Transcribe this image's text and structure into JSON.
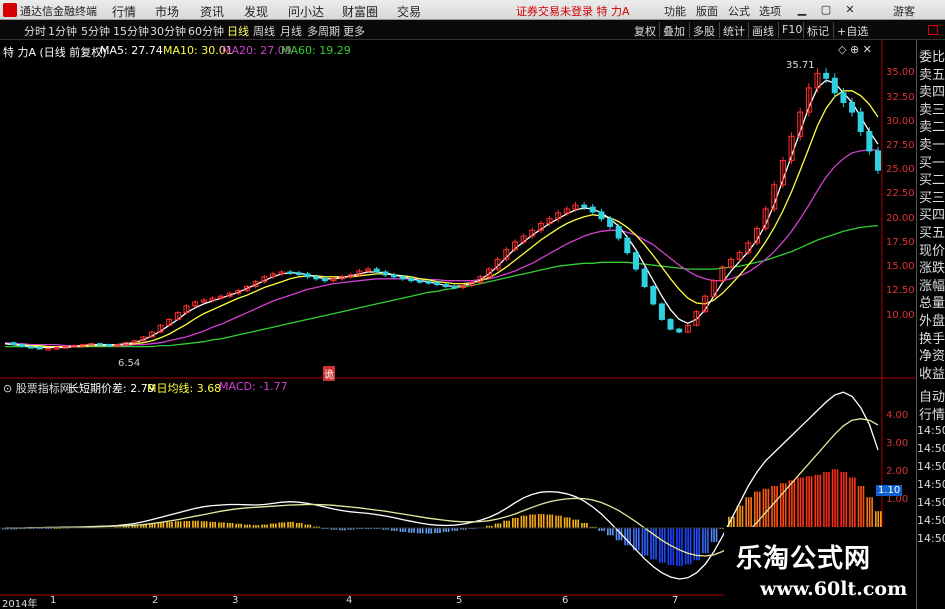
{
  "app": {
    "title": "通达信金融终端",
    "menu": [
      "行情",
      "市场",
      "资讯",
      "发现",
      "问小达",
      "财富圈",
      "交易"
    ],
    "status_warning": "证券交易未登录  特 力A",
    "right_menu": [
      "功能",
      "版面",
      "公式",
      "选项"
    ],
    "user": "游客"
  },
  "toolbar": {
    "periods": [
      "分时",
      "1分钟",
      "5分钟",
      "15分钟",
      "30分钟",
      "60分钟",
      "日线",
      "周线",
      "月线",
      "多周期",
      "更多"
    ],
    "active_period": "日线",
    "tools": [
      "复权",
      "叠加",
      "多股",
      "统计",
      "画线",
      "F10",
      "标记",
      "+自选"
    ],
    "side_corner": "L\n₩"
  },
  "stock": {
    "name_line": "特 力A  (日线 前复权)",
    "ma_legend": [
      {
        "label": "MA5: 27.74",
        "color": "#ffffff"
      },
      {
        "label": "MA10: 30.01",
        "color": "#ffff40"
      },
      {
        "label": "MA20: 27.09",
        "color": "#d040d0"
      },
      {
        "label": "MA60: 19.29",
        "color": "#30d030"
      }
    ],
    "high_label": "35.71",
    "low_label": "6.54",
    "marker": "诡",
    "y_axis": [
      "35.00",
      "32.50",
      "30.00",
      "27.50",
      "25.00",
      "22.50",
      "20.00",
      "17.50",
      "15.00",
      "12.50",
      "10.00"
    ]
  },
  "macd": {
    "title": "股票指标网",
    "legend": [
      {
        "label": "长短期价差: 2.79",
        "color": "#ffffff"
      },
      {
        "label": "M日均线: 3.68",
        "color": "#ffff40"
      },
      {
        "label": "MACD: -1.77",
        "color": "#d040d0"
      }
    ],
    "y_axis": [
      "4.00",
      "3.00",
      "2.00",
      "1.10",
      "1.00"
    ],
    "current_value": "1.10"
  },
  "x_axis": {
    "labels": [
      "2014年",
      "1",
      "2",
      "3",
      "4",
      "5",
      "6",
      "7"
    ]
  },
  "sidebar": {
    "labels": [
      "委比",
      "卖五",
      "卖四",
      "卖三",
      "卖二",
      "卖一",
      "买一",
      "买二",
      "买三",
      "买四",
      "买五",
      "现价",
      "涨跌",
      "涨幅",
      "总量",
      "外盘",
      "换手",
      "净资",
      "收益"
    ],
    "bottom_labels": [
      "自动",
      "行情"
    ],
    "times": [
      "14:50",
      "14:50",
      "14:50",
      "14:50",
      "14:50",
      "14:50",
      "14:50"
    ]
  },
  "watermark": {
    "text": "乐淘公式网",
    "url": "www.60lt.com"
  },
  "chart_data": {
    "type": "candlestick",
    "ylim": [
      5,
      37
    ],
    "price_path": [
      7.2,
      7.0,
      6.8,
      6.7,
      6.6,
      6.6,
      6.7,
      6.8,
      6.9,
      7.0,
      7.1,
      7.0,
      6.9,
      7.0,
      7.2,
      7.4,
      7.8,
      8.3,
      9.0,
      9.6,
      10.3,
      11.0,
      11.4,
      11.6,
      11.8,
      12.0,
      12.3,
      12.6,
      13.0,
      13.5,
      14.0,
      14.3,
      14.5,
      14.4,
      14.3,
      14.0,
      13.8,
      13.6,
      13.8,
      14.0,
      14.2,
      14.6,
      14.8,
      14.5,
      14.2,
      14.0,
      13.8,
      13.6,
      13.5,
      13.4,
      13.2,
      13.0,
      12.9,
      13.1,
      13.4,
      14.0,
      14.8,
      15.8,
      16.8,
      17.6,
      18.2,
      18.8,
      19.5,
      20.0,
      20.6,
      21.0,
      21.4,
      21.2,
      20.7,
      20.0,
      19.2,
      18.0,
      16.5,
      14.8,
      13.0,
      11.2,
      9.6,
      8.6,
      8.3,
      9.0,
      10.4,
      12.0,
      13.6,
      15.0,
      15.8,
      16.5,
      17.5,
      19.0,
      21.0,
      23.5,
      26.0,
      28.5,
      31.0,
      33.5,
      35.0,
      34.5,
      33.0,
      32.0,
      31.0,
      29.0,
      27.0,
      25.0
    ],
    "ma5": [
      7.1,
      7.0,
      6.9,
      6.8,
      6.7,
      6.7,
      6.7,
      6.7,
      6.8,
      6.9,
      7.0,
      7.0,
      7.0,
      7.0,
      7.1,
      7.2,
      7.5,
      7.9,
      8.4,
      9.0,
      9.6,
      10.3,
      10.8,
      11.2,
      11.5,
      11.8,
      12.1,
      12.4,
      12.8,
      13.2,
      13.6,
      14.0,
      14.3,
      14.4,
      14.4,
      14.2,
      14.0,
      13.8,
      13.8,
      13.9,
      14.1,
      14.3,
      14.5,
      14.5,
      14.4,
      14.2,
      14.0,
      13.8,
      13.6,
      13.5,
      13.3,
      13.1,
      13.0,
      13.1,
      13.3,
      13.7,
      14.3,
      15.1,
      16.0,
      16.9,
      17.6,
      18.3,
      18.9,
      19.5,
      20.0,
      20.5,
      20.9,
      21.1,
      21.0,
      20.6,
      20.0,
      19.2,
      18.1,
      16.8,
      15.2,
      13.6,
      12.0,
      10.6,
      9.6,
      9.2,
      9.6,
      10.6,
      12.0,
      13.4,
      14.6,
      15.6,
      16.6,
      17.8,
      19.4,
      21.5,
      24.0,
      26.5,
      29.0,
      31.5,
      33.5,
      34.3,
      34.0,
      33.0,
      32.0,
      30.5,
      29.0,
      27.7
    ],
    "ma10": [
      7.1,
      7.0,
      7.0,
      6.9,
      6.9,
      6.8,
      6.8,
      6.8,
      6.8,
      6.8,
      6.9,
      6.9,
      6.9,
      7.0,
      7.0,
      7.1,
      7.2,
      7.4,
      7.7,
      8.1,
      8.6,
      9.1,
      9.7,
      10.2,
      10.6,
      11.0,
      11.4,
      11.8,
      12.1,
      12.5,
      12.9,
      13.2,
      13.5,
      13.8,
      14.0,
      14.1,
      14.1,
      14.0,
      14.0,
      14.0,
      14.0,
      14.1,
      14.2,
      14.3,
      14.3,
      14.2,
      14.1,
      14.0,
      13.8,
      13.7,
      13.5,
      13.4,
      13.3,
      13.3,
      13.4,
      13.6,
      13.9,
      14.4,
      15.0,
      15.7,
      16.4,
      17.1,
      17.8,
      18.4,
      19.0,
      19.5,
      19.9,
      20.2,
      20.4,
      20.3,
      20.1,
      19.7,
      19.1,
      18.3,
      17.3,
      16.2,
      15.0,
      13.8,
      12.7,
      11.8,
      11.3,
      11.2,
      11.6,
      12.3,
      13.2,
      14.2,
      15.2,
      16.3,
      17.6,
      19.1,
      20.8,
      22.8,
      25.0,
      27.3,
      29.6,
      31.4,
      32.6,
      33.2,
      33.2,
      32.7,
      31.8,
      30.5
    ],
    "ma20": [
      7.2,
      7.1,
      7.1,
      7.0,
      7.0,
      7.0,
      7.0,
      6.9,
      6.9,
      6.9,
      6.9,
      6.9,
      6.9,
      6.9,
      6.9,
      7.0,
      7.0,
      7.1,
      7.2,
      7.4,
      7.6,
      7.8,
      8.1,
      8.4,
      8.8,
      9.1,
      9.5,
      9.9,
      10.3,
      10.7,
      11.1,
      11.5,
      11.8,
      12.1,
      12.4,
      12.7,
      12.9,
      13.1,
      13.3,
      13.4,
      13.5,
      13.6,
      13.7,
      13.8,
      13.8,
      13.8,
      13.8,
      13.8,
      13.8,
      13.7,
      13.7,
      13.6,
      13.6,
      13.6,
      13.6,
      13.7,
      13.8,
      14.0,
      14.3,
      14.6,
      15.0,
      15.4,
      15.9,
      16.4,
      16.9,
      17.4,
      17.8,
      18.2,
      18.5,
      18.7,
      18.8,
      18.8,
      18.6,
      18.3,
      17.8,
      17.3,
      16.6,
      15.9,
      15.2,
      14.6,
      14.1,
      13.8,
      13.6,
      13.6,
      13.8,
      14.1,
      14.5,
      15.1,
      15.8,
      16.6,
      17.6,
      18.7,
      20.0,
      21.4,
      22.9,
      24.3,
      25.4,
      26.2,
      26.8,
      27.0,
      27.1,
      27.09
    ],
    "ma60": [
      6.8,
      6.8,
      6.8,
      6.8,
      6.8,
      6.8,
      6.8,
      6.8,
      6.8,
      6.8,
      6.8,
      6.8,
      6.8,
      6.8,
      6.8,
      6.8,
      6.8,
      6.8,
      6.9,
      6.9,
      7.0,
      7.1,
      7.2,
      7.3,
      7.5,
      7.6,
      7.8,
      8.0,
      8.2,
      8.4,
      8.6,
      8.8,
      9.0,
      9.2,
      9.4,
      9.6,
      9.8,
      10.0,
      10.2,
      10.4,
      10.6,
      10.8,
      11.0,
      11.2,
      11.4,
      11.6,
      11.8,
      12.0,
      12.2,
      12.4,
      12.5,
      12.7,
      12.8,
      13.0,
      13.1,
      13.3,
      13.5,
      13.7,
      13.9,
      14.1,
      14.3,
      14.5,
      14.7,
      14.9,
      15.1,
      15.2,
      15.3,
      15.4,
      15.4,
      15.5,
      15.5,
      15.5,
      15.5,
      15.4,
      15.3,
      15.2,
      15.1,
      15.0,
      14.9,
      14.8,
      14.8,
      14.8,
      14.8,
      14.9,
      15.0,
      15.1,
      15.3,
      15.5,
      15.7,
      16.0,
      16.3,
      16.6,
      17.0,
      17.4,
      17.8,
      18.1,
      18.4,
      18.7,
      18.9,
      19.1,
      19.2,
      19.29
    ],
    "macd_hist": [
      -0.05,
      -0.05,
      -0.04,
      -0.03,
      -0.02,
      -0.01,
      0.0,
      0.01,
      0.02,
      0.02,
      0.02,
      0.02,
      0.02,
      0.03,
      0.05,
      0.08,
      0.12,
      0.16,
      0.2,
      0.22,
      0.24,
      0.25,
      0.26,
      0.24,
      0.22,
      0.2,
      0.18,
      0.15,
      0.12,
      0.1,
      0.12,
      0.16,
      0.2,
      0.22,
      0.18,
      0.12,
      0.05,
      -0.02,
      -0.06,
      -0.08,
      -0.06,
      -0.04,
      -0.02,
      -0.03,
      -0.06,
      -0.1,
      -0.14,
      -0.17,
      -0.19,
      -0.2,
      -0.18,
      -0.14,
      -0.1,
      -0.06,
      -0.02,
      0.02,
      0.08,
      0.16,
      0.26,
      0.36,
      0.44,
      0.48,
      0.5,
      0.48,
      0.44,
      0.38,
      0.3,
      0.18,
      0.04,
      -0.1,
      -0.26,
      -0.44,
      -0.62,
      -0.8,
      -0.98,
      -1.12,
      -1.24,
      -1.32,
      -1.36,
      -1.3,
      -1.15,
      -0.9,
      -0.5,
      0.0,
      0.4,
      0.8,
      1.1,
      1.3,
      1.4,
      1.5,
      1.6,
      1.7,
      1.8,
      1.85,
      1.9,
      2.0,
      2.1,
      2.0,
      1.8,
      1.5,
      1.1,
      0.6
    ],
    "dif": [
      0.0,
      0.0,
      0.0,
      0.01,
      0.01,
      0.02,
      0.02,
      0.03,
      0.03,
      0.04,
      0.05,
      0.06,
      0.07,
      0.09,
      0.12,
      0.16,
      0.22,
      0.3,
      0.38,
      0.46,
      0.54,
      0.62,
      0.7,
      0.76,
      0.8,
      0.82,
      0.84,
      0.84,
      0.83,
      0.82,
      0.84,
      0.88,
      0.92,
      0.94,
      0.92,
      0.88,
      0.82,
      0.75,
      0.68,
      0.62,
      0.58,
      0.55,
      0.52,
      0.48,
      0.43,
      0.37,
      0.3,
      0.24,
      0.18,
      0.13,
      0.1,
      0.09,
      0.1,
      0.14,
      0.2,
      0.28,
      0.38,
      0.52,
      0.7,
      0.9,
      1.08,
      1.2,
      1.28,
      1.3,
      1.28,
      1.22,
      1.12,
      0.96,
      0.75,
      0.5,
      0.2,
      -0.12,
      -0.45,
      -0.78,
      -1.1,
      -1.38,
      -1.6,
      -1.75,
      -1.82,
      -1.78,
      -1.6,
      -1.3,
      -0.85,
      -0.3,
      0.3,
      0.9,
      1.5,
      2.0,
      2.4,
      2.7,
      3.0,
      3.3,
      3.6,
      3.9,
      4.2,
      4.5,
      4.75,
      4.85,
      4.7,
      4.3,
      3.7,
      2.79
    ],
    "dea": [
      0.0,
      0.0,
      0.0,
      0.0,
      0.01,
      0.01,
      0.01,
      0.02,
      0.02,
      0.03,
      0.04,
      0.05,
      0.06,
      0.07,
      0.08,
      0.1,
      0.12,
      0.16,
      0.2,
      0.25,
      0.3,
      0.36,
      0.42,
      0.48,
      0.54,
      0.6,
      0.65,
      0.69,
      0.72,
      0.74,
      0.76,
      0.78,
      0.8,
      0.82,
      0.83,
      0.84,
      0.84,
      0.83,
      0.81,
      0.78,
      0.75,
      0.72,
      0.68,
      0.64,
      0.6,
      0.55,
      0.5,
      0.45,
      0.4,
      0.35,
      0.31,
      0.27,
      0.24,
      0.22,
      0.22,
      0.23,
      0.26,
      0.32,
      0.4,
      0.5,
      0.62,
      0.74,
      0.85,
      0.94,
      1.0,
      1.04,
      1.06,
      1.05,
      1.0,
      0.91,
      0.78,
      0.62,
      0.43,
      0.22,
      0.0,
      -0.22,
      -0.44,
      -0.62,
      -0.78,
      -0.9,
      -0.98,
      -1.0,
      -0.96,
      -0.84,
      -0.66,
      -0.42,
      -0.12,
      0.2,
      0.55,
      0.9,
      1.25,
      1.6,
      1.95,
      2.3,
      2.65,
      3.0,
      3.35,
      3.65,
      3.85,
      3.9,
      3.85,
      3.68
    ]
  }
}
